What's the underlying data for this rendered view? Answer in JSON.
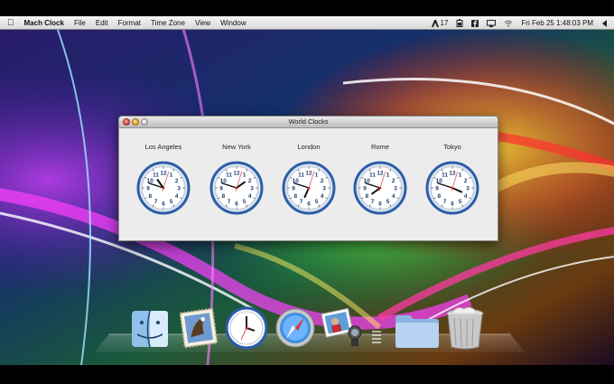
{
  "menubar": {
    "apple_icon": "apple-icon",
    "app_name": "Mach Clock",
    "menus": [
      "File",
      "Edit",
      "Format",
      "Time Zone",
      "View",
      "Window"
    ],
    "status_calendar": "17",
    "datetime": "Fri Feb 25  1:48:03 PM",
    "icons": [
      "adobe-icon",
      "calendar-icon",
      "battery-icon",
      "facebook-icon",
      "display-icon",
      "wifi-icon",
      "volume-icon",
      "bluetooth-icon"
    ]
  },
  "window": {
    "title": "World Clocks",
    "clocks": [
      {
        "city": "Los Angeles",
        "hour": 10,
        "minute": 48,
        "second": 3
      },
      {
        "city": "New York",
        "hour": 1,
        "minute": 48,
        "second": 3
      },
      {
        "city": "London",
        "hour": 6,
        "minute": 48,
        "second": 3
      },
      {
        "city": "Rome",
        "hour": 7,
        "minute": 48,
        "second": 3
      },
      {
        "city": "Tokyo",
        "hour": 3,
        "minute": 48,
        "second": 3
      }
    ]
  },
  "dock": {
    "items": [
      "finder-icon",
      "mail-icon",
      "clock-app-icon",
      "safari-icon",
      "iphoto-icon",
      "downloads-folder-icon",
      "trash-icon"
    ]
  }
}
